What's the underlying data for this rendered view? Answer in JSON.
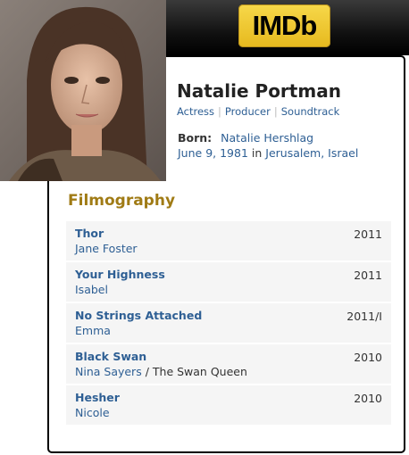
{
  "logo": {
    "text": "IMDb"
  },
  "person": {
    "name": "Natalie Portman",
    "roles": [
      "Actress",
      "Producer",
      "Soundtrack"
    ],
    "born_label": "Born:",
    "birth_name": "Natalie Hershlag",
    "birth_date": "June 9, 1981",
    "in_word": "in",
    "birth_place": "Jerusalem, Israel"
  },
  "filmography": {
    "heading": "Filmography",
    "films": [
      {
        "title": "Thor",
        "role": "Jane Foster",
        "role_extra": "",
        "year": "2011"
      },
      {
        "title": "Your Highness",
        "role": "Isabel",
        "role_extra": "",
        "year": "2011"
      },
      {
        "title": "No Strings Attached",
        "role": "Emma",
        "role_extra": "",
        "year": "2011/I"
      },
      {
        "title": "Black Swan",
        "role": "Nina Sayers",
        "role_extra": "The Swan Queen",
        "year": "2010"
      },
      {
        "title": "Hesher",
        "role": "Nicole",
        "role_extra": "",
        "year": "2010"
      }
    ]
  }
}
